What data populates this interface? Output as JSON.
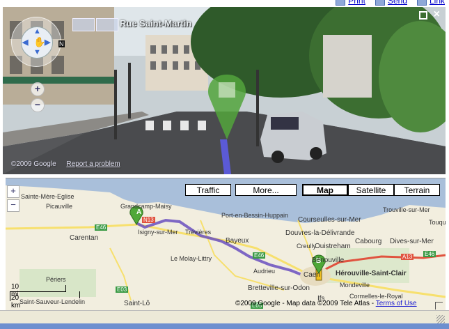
{
  "top_links": {
    "print": "Print",
    "send": "Send",
    "link": "Link"
  },
  "street_view": {
    "title": "Rue Saint-Martin",
    "copyright": "©2009 Google",
    "report": "Report a problem",
    "zoom_in": "+",
    "zoom_out": "−",
    "compass_mark": "N"
  },
  "map_types": {
    "traffic": "Traffic",
    "more": "More...",
    "map": "Map",
    "satellite": "Satellite",
    "terrain": "Terrain",
    "selected": "Map"
  },
  "map_zoom": {
    "in": "+",
    "out": "−"
  },
  "route_markers": {
    "start": "A",
    "end": "B"
  },
  "places": {
    "sainte_mere": "Sainte-Mère-Eglise",
    "grandcamp": "Grandcamp-Maisy",
    "picauville": "Picauville",
    "carentan": "Carentan",
    "isigny": "Isigny-sur-Mer",
    "trevieres": "Trévières",
    "port_en_bessin": "Port-en-Bessin-Huppain",
    "courseulles": "Courseulles-sur-Mer",
    "douvres": "Douvres-la-Délivrande",
    "bayeux": "Bayeux",
    "creully": "Creully",
    "ouistreham": "Ouistreham",
    "cabourg": "Cabourg",
    "dives": "Dives-sur-Mer",
    "trouville": "Trouville-sur-Mer",
    "touques": "Touque",
    "le_molay": "Le Molay-Littry",
    "audrieu": "Audrieu",
    "benouville": "Bénouville",
    "herouville": "Hérouville-Saint-Clair",
    "mondeville": "Mondeville",
    "bretteville": "Bretteville-sur-Odon",
    "ifs": "Ifs",
    "cormelles": "Cormelles-le-Royal",
    "periers": "Périers",
    "saint_sauveur": "Saint-Sauveur-Lendelin",
    "saint_lo": "Saint-Lô",
    "caen": "Caen",
    "road_n13": "N13",
    "road_e46": "E46",
    "road_e46b": "E46",
    "road_e46c": "E46",
    "road_a13": "A13",
    "road_e03": "E03",
    "road_e05": "E05"
  },
  "scale": {
    "miles": "10 mi",
    "km": "20 km"
  },
  "map_copyright": "©2009 Google - Map data ©2009 Tele Atlas - ",
  "terms": "Terms of Use",
  "colors": {
    "route": "#6a4fc0",
    "marker_green": "#4fa838",
    "road_yellow": "#f7e06e",
    "road_red": "#e0533f",
    "sea": "#a9bfda"
  }
}
